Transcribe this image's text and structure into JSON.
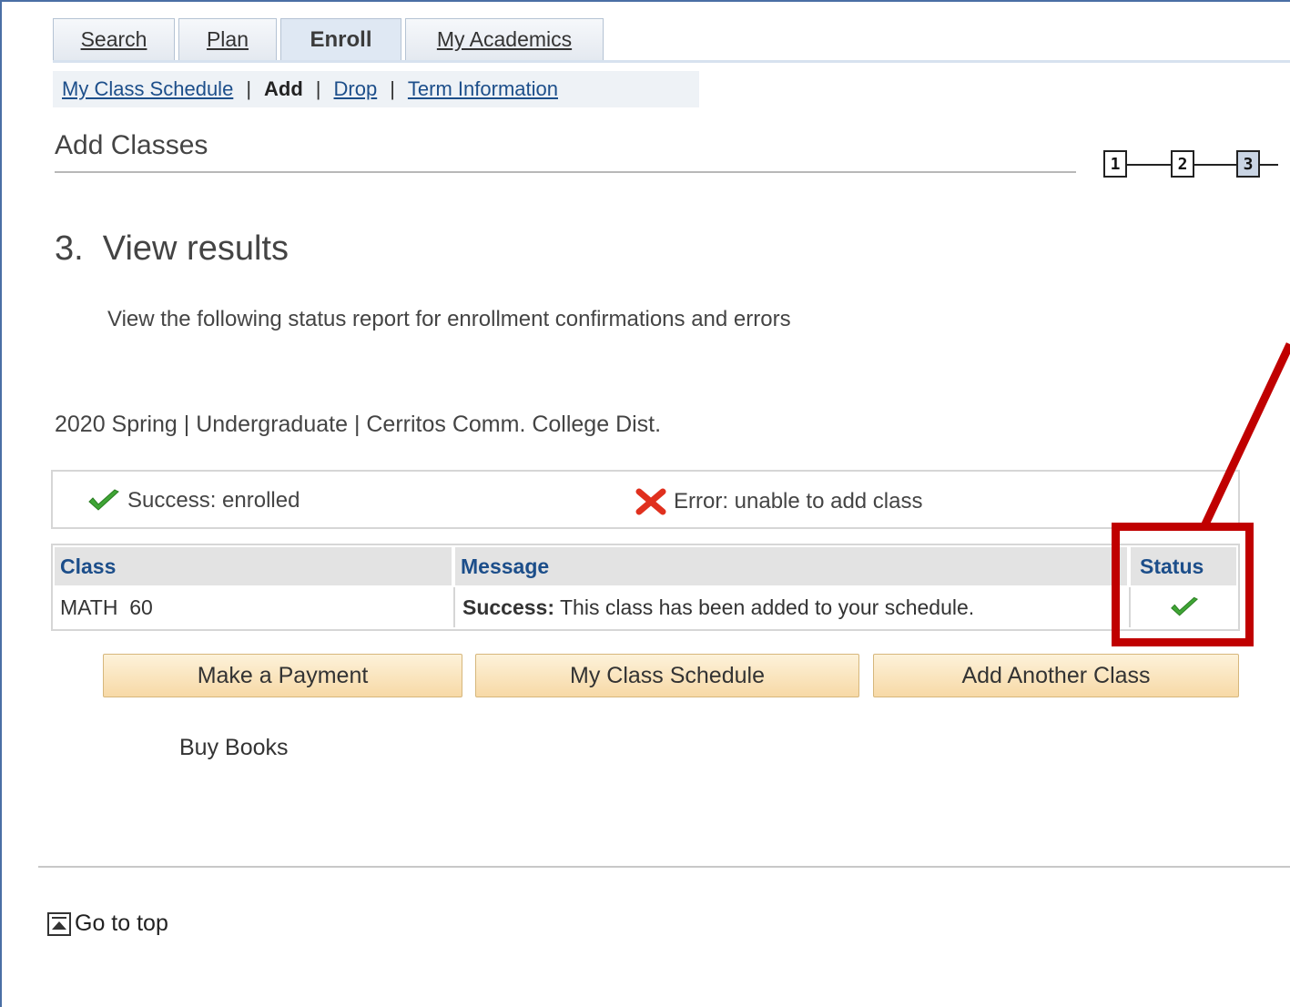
{
  "tabs": [
    {
      "label": "Search",
      "active": false
    },
    {
      "label": "Plan",
      "active": false
    },
    {
      "label": "Enroll",
      "active": true
    },
    {
      "label": "My Academics",
      "active": false
    }
  ],
  "subnav": {
    "my_class_schedule": "My Class Schedule",
    "add": "Add",
    "drop": "Drop",
    "term_information": "Term Information",
    "separator": "|"
  },
  "page_title": "Add Classes",
  "steps": [
    "1",
    "2",
    "3"
  ],
  "current_step": "3",
  "section_title": "3.  View results",
  "instructions": "View the following status report for enrollment confirmations and errors",
  "term_info": "2020 Spring | Undergraduate | Cerritos Comm. College Dist.",
  "legend": {
    "success": "Success: enrolled",
    "error": "Error: unable to add class"
  },
  "table": {
    "headers": {
      "class": "Class",
      "message": "Message",
      "status": "Status"
    },
    "rows": [
      {
        "class": "MATH  60",
        "message_bold": "Success:",
        "message": " This class has been added to your schedule.",
        "status_icon": "green-check-icon"
      }
    ]
  },
  "buttons": {
    "make_payment": "Make a Payment",
    "my_class_schedule": "My Class Schedule",
    "add_another_class": "Add Another Class"
  },
  "buy_books": "Buy Books",
  "go_to_top": "Go to top",
  "colors": {
    "link": "#1c4e8a",
    "annotation": "#c00000",
    "button_top": "#fdf2da",
    "button_bottom": "#f7d9a6",
    "success_green": "#3fa535",
    "error_red": "#e0301e"
  }
}
